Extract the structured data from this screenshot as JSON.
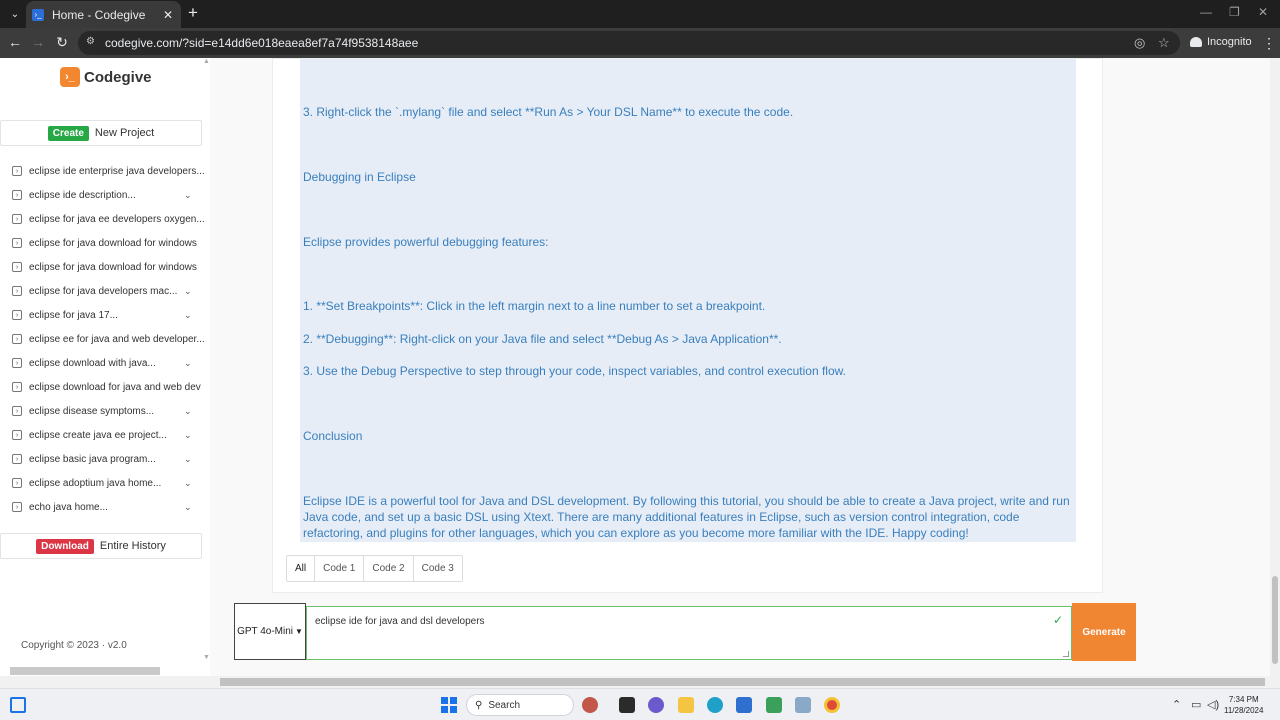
{
  "browser": {
    "tab_title": "Home - Codegive",
    "url": "codegive.com/?sid=e14dd6e018eaea8ef7a74f9538148aee",
    "incognito_label": "Incognito"
  },
  "sidebar": {
    "logo_text": "Codegive",
    "create_badge": "Create",
    "create_label": "New Project",
    "history": [
      {
        "label": "eclipse ide enterprise java developers...",
        "chevron": false
      },
      {
        "label": "eclipse ide description...",
        "chevron": true
      },
      {
        "label": "eclipse for java ee developers oxygen...",
        "chevron": false
      },
      {
        "label": "eclipse for java download for windows",
        "chevron": false
      },
      {
        "label": "eclipse for java download for windows",
        "chevron": false
      },
      {
        "label": "eclipse for java developers mac...",
        "chevron": true
      },
      {
        "label": "eclipse for java 17...",
        "chevron": true
      },
      {
        "label": "eclipse ee for java and web developer...",
        "chevron": false
      },
      {
        "label": "eclipse download with java...",
        "chevron": true
      },
      {
        "label": "eclipse download for java and web dev",
        "chevron": false
      },
      {
        "label": "eclipse disease symptoms...",
        "chevron": true
      },
      {
        "label": "eclipse create java ee project...",
        "chevron": true
      },
      {
        "label": "eclipse basic java program...",
        "chevron": true
      },
      {
        "label": "eclipse adoptium java home...",
        "chevron": true
      },
      {
        "label": "echo java home...",
        "chevron": true
      }
    ],
    "download_badge": "Download",
    "download_label": "Entire History",
    "copyright": "Copyright © 2023  ·  v2.0"
  },
  "content": {
    "paragraphs": [
      "3. Right-click the `.mylang` file and select **Run As > Your DSL Name** to execute the code.",
      "Debugging in Eclipse",
      "Eclipse provides powerful debugging features:",
      "1. **Set Breakpoints**: Click in the left margin next to a line number to set a breakpoint.",
      "2. **Debugging**: Right-click on your Java file and select **Debug As > Java Application**.",
      "3. Use the Debug Perspective to step through your code, inspect variables, and control execution flow.",
      "Conclusion",
      "Eclipse IDE is a powerful tool for Java and DSL development. By following this tutorial, you should be able to create a Java project, write and run Java code, and set up a basic DSL using Xtext. There are many additional features in Eclipse, such as version control integration, code refactoring, and plugins for other languages, which you can explore as you become more familiar with the IDE. Happy coding!"
    ],
    "tabs": [
      "All",
      "Code 1",
      "Code 2",
      "Code 3"
    ]
  },
  "prompt": {
    "model": "GPT 4o-Mini",
    "value": "eclipse ide for java and dsl developers",
    "generate_label": "Generate"
  },
  "taskbar": {
    "search_label": "Search",
    "time": "7:34 PM",
    "date": "11/28/2024"
  }
}
